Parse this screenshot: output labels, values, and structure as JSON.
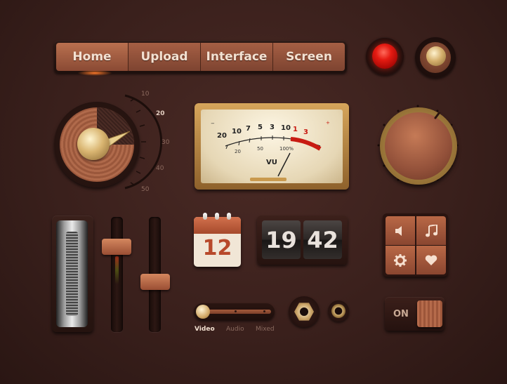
{
  "nav": {
    "items": [
      {
        "label": "Home"
      },
      {
        "label": "Upload"
      },
      {
        "label": "Interface"
      },
      {
        "label": "Screen"
      }
    ]
  },
  "dial_scale": [
    "10",
    "20",
    "30",
    "40",
    "50"
  ],
  "vu_meter": {
    "scale_top": [
      "20",
      "10",
      "7",
      "5",
      "3",
      "1",
      "0",
      "1",
      "3"
    ],
    "scale_bottom": [
      "20",
      "50",
      "100%"
    ],
    "minus": "−",
    "plus": "+",
    "label": "VU"
  },
  "calendar": {
    "day": "12"
  },
  "clock": {
    "hours": "19",
    "minutes": "42"
  },
  "media_buttons": [
    {
      "icon": "speaker-icon"
    },
    {
      "icon": "music-note-icon"
    },
    {
      "icon": "gear-icon"
    },
    {
      "icon": "heart-icon"
    }
  ],
  "source_toggle": {
    "options": [
      "Video",
      "Audio",
      "Mixed"
    ],
    "selected": "Video"
  },
  "power_switch": {
    "label": "ON"
  },
  "colors": {
    "background": "#3a201c",
    "accent_copper": "#a55f44",
    "indicator_red": "#e51b12",
    "brass": "#d5b06d"
  }
}
